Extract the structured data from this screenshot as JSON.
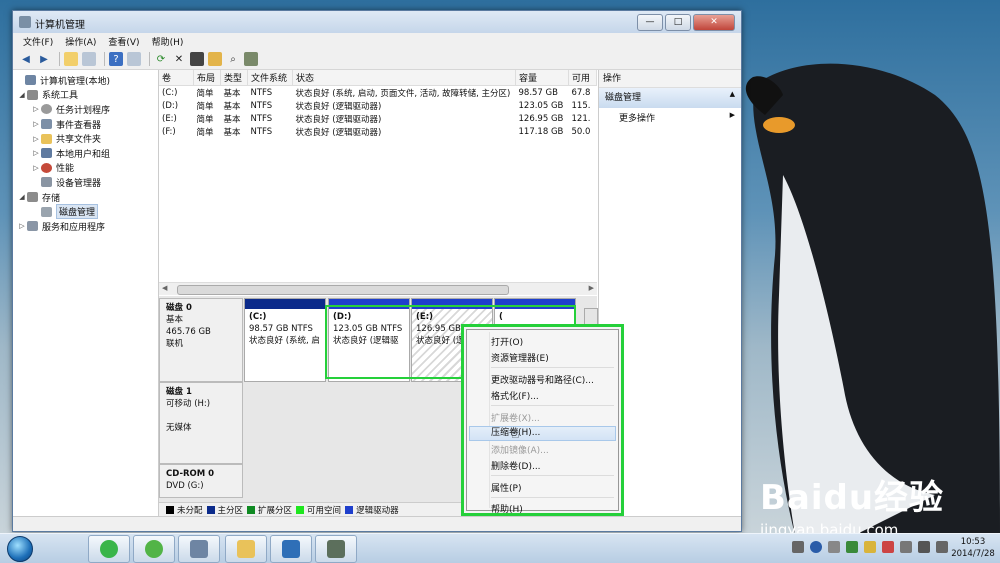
{
  "window": {
    "title": "计算机管理"
  },
  "menu": [
    "文件(F)",
    "操作(A)",
    "查看(V)",
    "帮助(H)"
  ],
  "tree": [
    {
      "label": "计算机管理(本地)",
      "level": 0,
      "icon": "computer-icon"
    },
    {
      "label": "系统工具",
      "level": 1,
      "icon": "tools-icon"
    },
    {
      "label": "任务计划程序",
      "level": 2,
      "icon": "clock-icon"
    },
    {
      "label": "事件查看器",
      "level": 2,
      "icon": "event-icon"
    },
    {
      "label": "共享文件夹",
      "level": 2,
      "icon": "folder-icon"
    },
    {
      "label": "本地用户和组",
      "level": 2,
      "icon": "users-icon"
    },
    {
      "label": "性能",
      "level": 2,
      "icon": "performance-icon"
    },
    {
      "label": "设备管理器",
      "level": 2,
      "icon": "device-icon"
    },
    {
      "label": "存储",
      "level": 1,
      "icon": "storage-icon"
    },
    {
      "label": "磁盘管理",
      "level": 2,
      "icon": "disk-icon"
    },
    {
      "label": "服务和应用程序",
      "level": 1,
      "icon": "services-icon"
    }
  ],
  "volumes": {
    "columns": [
      "卷",
      "布局",
      "类型",
      "文件系统",
      "状态",
      "容量",
      "可用"
    ],
    "rows": [
      [
        "(C:)",
        "简单",
        "基本",
        "NTFS",
        "状态良好 (系统, 启动, 页面文件, 活动, 故障转储, 主分区)",
        "98.57 GB",
        "67.8"
      ],
      [
        "(D:)",
        "简单",
        "基本",
        "NTFS",
        "状态良好 (逻辑驱动器)",
        "123.05 GB",
        "115."
      ],
      [
        "(E:)",
        "简单",
        "基本",
        "NTFS",
        "状态良好 (逻辑驱动器)",
        "126.95 GB",
        "121."
      ],
      [
        "(F:)",
        "简单",
        "基本",
        "NTFS",
        "状态良好 (逻辑驱动器)",
        "117.18 GB",
        "50.0"
      ]
    ]
  },
  "disks": {
    "disk0": {
      "name": "磁盘 0",
      "type": "基本",
      "size": "465.76 GB",
      "state": "联机"
    },
    "disk1": {
      "name": "磁盘 1",
      "type": "可移动 (H:)",
      "media": "无媒体"
    },
    "cdrom": {
      "name": "CD-ROM 0",
      "type": "DVD (G:)"
    },
    "parts": [
      {
        "label": "(C:)",
        "size": "98.57 GB NTFS",
        "status": "状态良好 (系统, 启"
      },
      {
        "label": "(D:)",
        "size": "123.05 GB NTFS",
        "status": "状态良好 (逻辑驱"
      },
      {
        "label": "(E:)",
        "size": "126.95 GB",
        "status": "状态良好 (逻"
      },
      {
        "label": "(",
        "size": "",
        "status": ""
      }
    ]
  },
  "legend": [
    "未分配",
    "主分区",
    "扩展分区",
    "可用空间",
    "逻辑驱动器"
  ],
  "actions": {
    "header": "操作",
    "section": "磁盘管理",
    "more": "更多操作"
  },
  "context_menu": [
    {
      "label": "打开(O)",
      "state": "normal"
    },
    {
      "label": "资源管理器(E)",
      "state": "normal"
    },
    {
      "label": "更改驱动器号和路径(C)...",
      "state": "normal"
    },
    {
      "label": "格式化(F)...",
      "state": "normal"
    },
    {
      "label": "扩展卷(X)...",
      "state": "disabled"
    },
    {
      "label": "压缩卷(H)...",
      "state": "highlighted"
    },
    {
      "label": "添加镜像(A)...",
      "state": "disabled"
    },
    {
      "label": "删除卷(D)...",
      "state": "normal"
    },
    {
      "label": "属性(P)",
      "state": "normal"
    },
    {
      "label": "帮助(H)",
      "state": "normal"
    }
  ],
  "taskbar": {
    "time": "10:53",
    "date": "2014/7/28"
  },
  "watermark": {
    "logo": "Baidu经验",
    "url": "jingyan.baidu.com"
  },
  "colors": {
    "primary": "#0b2a8a",
    "logical": "#1e3fcc",
    "free": "#1ee61e",
    "extended": "#0f8a22",
    "unallocated": "#000000",
    "highlight": "#25d03a"
  }
}
